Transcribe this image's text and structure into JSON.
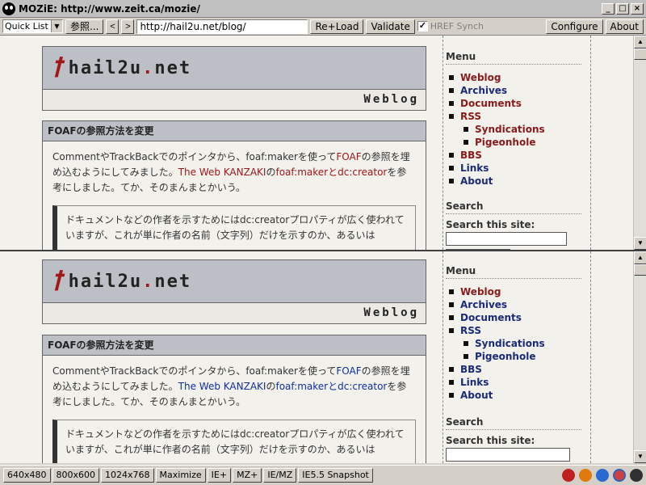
{
  "window": {
    "title": "MOZiE: http://www.zeit.ca/mozie/",
    "min": "_",
    "max": "□",
    "close": "×"
  },
  "toolbar": {
    "quick_list": "Quick List",
    "browse": "参照...",
    "back": "<",
    "forward": ">",
    "url": "http://hail2u.net/blog/",
    "reload": "Re+Load",
    "validate": "Validate",
    "href_synch_checked": "✓",
    "href_synch": "HREF Synch",
    "configure": "Configure",
    "about": "About"
  },
  "page": {
    "logo_glyph": "ꝉ",
    "logo_name": "hail2u",
    "logo_dot": ".",
    "logo_tld": "net",
    "section": "Weblog",
    "entry_title": "FOAFの参照方法を変更",
    "entry_p1": "CommentやTrackBackでのポインタから、foaf:makerを使って",
    "entry_link_foaf": "FOAF",
    "entry_p2": "の参照を埋め込むようにしてみました。",
    "entry_link_kanzaki": "The Web KANZAKI",
    "entry_p3": "の",
    "entry_link_maker": "foaf:makerとdc:creator",
    "entry_p4": "を参考にしました。てか、そのまんまとかいう。",
    "quote": "ドキュメントなどの作者を示すためにはdc:creatorプロパティが広く使われていますが、これが単に作者の名前（文字列）だけを示すのか、あるいは"
  },
  "sidebar": {
    "menu_heading": "Menu",
    "menu": [
      {
        "label": "Weblog",
        "tone": "red",
        "sub": false
      },
      {
        "label": "Archives",
        "tone": "blue",
        "sub": false
      },
      {
        "label": "Documents",
        "tone": "red",
        "sub": false
      },
      {
        "label": "RSS",
        "tone": "red",
        "sub": false
      },
      {
        "label": "Syndications",
        "tone": "red",
        "sub": true
      },
      {
        "label": "Pigeonhole",
        "tone": "red",
        "sub": true
      },
      {
        "label": "BBS",
        "tone": "red",
        "sub": false
      },
      {
        "label": "Links",
        "tone": "blue",
        "sub": false
      },
      {
        "label": "About",
        "tone": "blue",
        "sub": false
      }
    ],
    "menu_bottom": [
      {
        "label": "Weblog",
        "tone": "red",
        "sub": false
      },
      {
        "label": "Archives",
        "tone": "blue",
        "sub": false
      },
      {
        "label": "Documents",
        "tone": "blue",
        "sub": false
      },
      {
        "label": "RSS",
        "tone": "blue",
        "sub": false
      },
      {
        "label": "Syndications",
        "tone": "blue",
        "sub": true
      },
      {
        "label": "Pigeonhole",
        "tone": "blue",
        "sub": true
      },
      {
        "label": "BBS",
        "tone": "blue",
        "sub": false
      },
      {
        "label": "Links",
        "tone": "blue",
        "sub": false
      },
      {
        "label": "About",
        "tone": "blue",
        "sub": false
      }
    ],
    "search_heading": "Search",
    "search_label": "Search this site:"
  },
  "statusbar": {
    "items": [
      "640x480",
      "800x600",
      "1024x768",
      "Maximize",
      "IE+",
      "MZ+",
      "IE/MZ",
      "IE5.5 Snapshot"
    ]
  },
  "colors": {
    "accent_red": "#a01818",
    "link_blue": "#1030a0",
    "header_gray": "#bcc0c6"
  }
}
